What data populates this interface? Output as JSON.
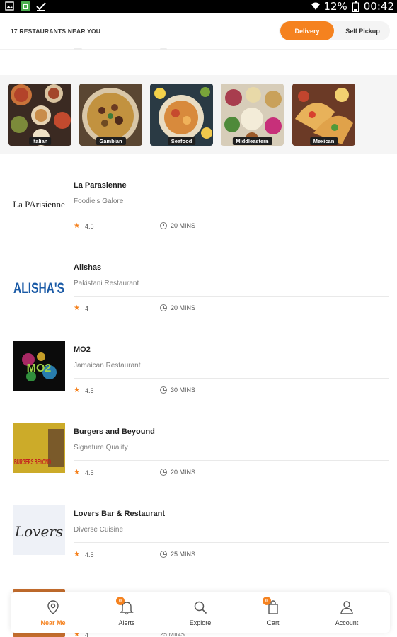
{
  "status_bar": {
    "battery": "12%",
    "time": "00:42"
  },
  "header": {
    "count_label": "17 RESTAURANTS NEAR YOU",
    "delivery_label": "Delivery",
    "pickup_label": "Self Pickup"
  },
  "cuisines": [
    {
      "label": "Italian"
    },
    {
      "label": "Gambian"
    },
    {
      "label": "Seafood"
    },
    {
      "label": "Middleastern"
    },
    {
      "label": "Mexican"
    }
  ],
  "restaurants": [
    {
      "name": "La Parasienne",
      "subtitle": "Foodie's Galore",
      "rating": "4.5",
      "time": "20 MINS",
      "logo_text": "La PArisienne"
    },
    {
      "name": "Alishas",
      "subtitle": "Pakistani Restaurant",
      "rating": "4",
      "time": "20 MINS",
      "logo_text": "ALISHA'S"
    },
    {
      "name": "MO2",
      "subtitle": "Jamaican Restaurant",
      "rating": "4.5",
      "time": "30 MINS",
      "logo_text": "MO2"
    },
    {
      "name": "Burgers and Beyound",
      "subtitle": "Signature Quality",
      "rating": "4.5",
      "time": "20 MINS",
      "logo_text": "BURGERS BEYOND"
    },
    {
      "name": "Lovers Bar & Restaurant",
      "subtitle": "Diverse Cuisine",
      "rating": "4.5",
      "time": "25 MINS",
      "logo_text": "Lovers"
    }
  ],
  "partial_row": {
    "rating": "4",
    "time": "25 MINS"
  },
  "nav": {
    "near_me": "Near Me",
    "alerts": "Alerts",
    "alerts_badge": "0",
    "explore": "Explore",
    "cart": "Cart",
    "cart_badge": "0",
    "account": "Account"
  },
  "colors": {
    "accent": "#f5821f",
    "text_dark": "#222222",
    "text_muted": "#7d7d7d"
  }
}
